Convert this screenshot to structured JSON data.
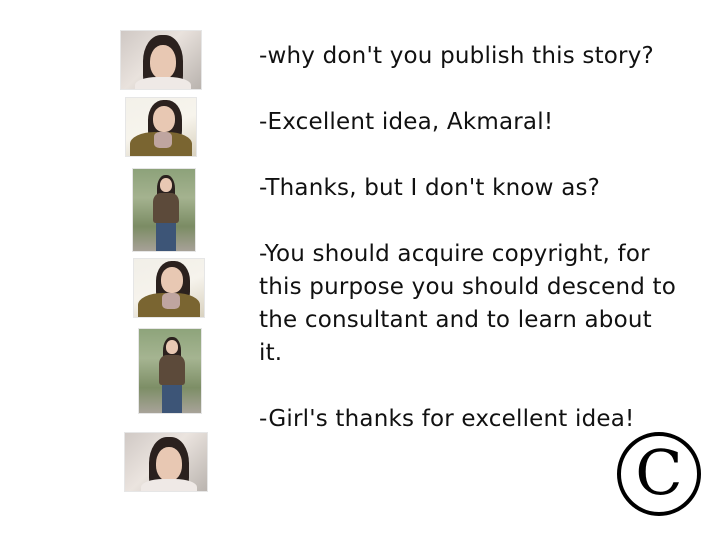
{
  "dialog": {
    "lines": [
      "-why don't you publish this story?",
      "-Excellent idea, Akmaral!",
      "-Thanks, but I don't know as?",
      "-You should acquire copyright, for this purpose you should descend to the consultant and to learn about it.",
      "-Girl's thanks for excellent idea!"
    ]
  },
  "copyright_mark": "C",
  "photos": [
    {
      "icon": "portrait-photo"
    },
    {
      "icon": "portrait-photo"
    },
    {
      "icon": "full-figure-photo"
    },
    {
      "icon": "portrait-photo"
    },
    {
      "icon": "full-figure-photo"
    },
    {
      "icon": "portrait-photo"
    }
  ]
}
